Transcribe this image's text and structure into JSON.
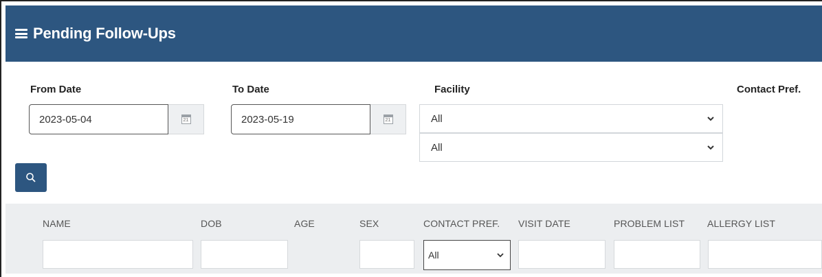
{
  "header": {
    "title": "Pending Follow-Ups",
    "menu_icon": "hamburger-icon"
  },
  "filters": {
    "from_date": {
      "label": "From Date",
      "value": "2023-05-04",
      "icon": "calendar-icon",
      "icon_text": "21"
    },
    "to_date": {
      "label": "To Date",
      "value": "2023-05-19",
      "icon": "calendar-icon",
      "icon_text": "21"
    },
    "facility": {
      "label": "Facility",
      "value": "All",
      "second_value": "All"
    },
    "contact_pref": {
      "label": "Contact Pref."
    },
    "search_icon": "search-icon"
  },
  "grid": {
    "columns": [
      "NAME",
      "DOB",
      "AGE",
      "SEX",
      "CONTACT PREF.",
      "VISIT DATE",
      "PROBLEM LIST",
      "ALLERGY LIST"
    ],
    "contact_pref_filter": "All"
  },
  "colors": {
    "header_bg": "#2d5680",
    "grid_header_bg": "#eceef0"
  }
}
